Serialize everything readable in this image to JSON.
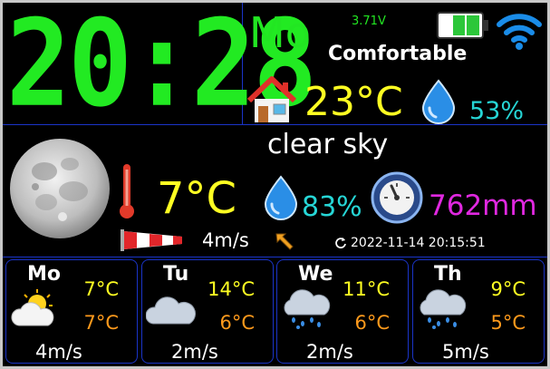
{
  "clock": {
    "time": "20:28"
  },
  "header": {
    "day": "Mo",
    "voltage": "3.71V",
    "battery_icon": "battery-icon",
    "wifi_icon": "wifi-icon",
    "comfort": "Comfortable"
  },
  "indoor": {
    "temperature": "23°C",
    "humidity": "53%"
  },
  "current": {
    "condition": "clear sky",
    "temperature": "7°C",
    "humidity": "83%",
    "pressure": "762mm",
    "wind": "4m/s",
    "updated_icon": "refresh-icon",
    "updated": "2022-11-14 20:15:51"
  },
  "forecast": [
    {
      "day": "Mo",
      "high": "7°C",
      "low": "7°C",
      "wind": "4m/s",
      "icon": "partly-cloudy-icon"
    },
    {
      "day": "Tu",
      "high": "14°C",
      "low": "6°C",
      "wind": "2m/s",
      "icon": "cloud-icon"
    },
    {
      "day": "We",
      "high": "11°C",
      "low": "6°C",
      "wind": "2m/s",
      "icon": "rain-cloud-icon"
    },
    {
      "day": "Th",
      "high": "9°C",
      "low": "5°C",
      "wind": "5m/s",
      "icon": "rain-cloud-icon"
    }
  ],
  "colors": {
    "green": "#22e622",
    "yellow": "#ffff22",
    "cyan": "#26d6d6",
    "magenta": "#e028e0",
    "orange": "#ff9a1c",
    "divider": "#1a34c8"
  }
}
